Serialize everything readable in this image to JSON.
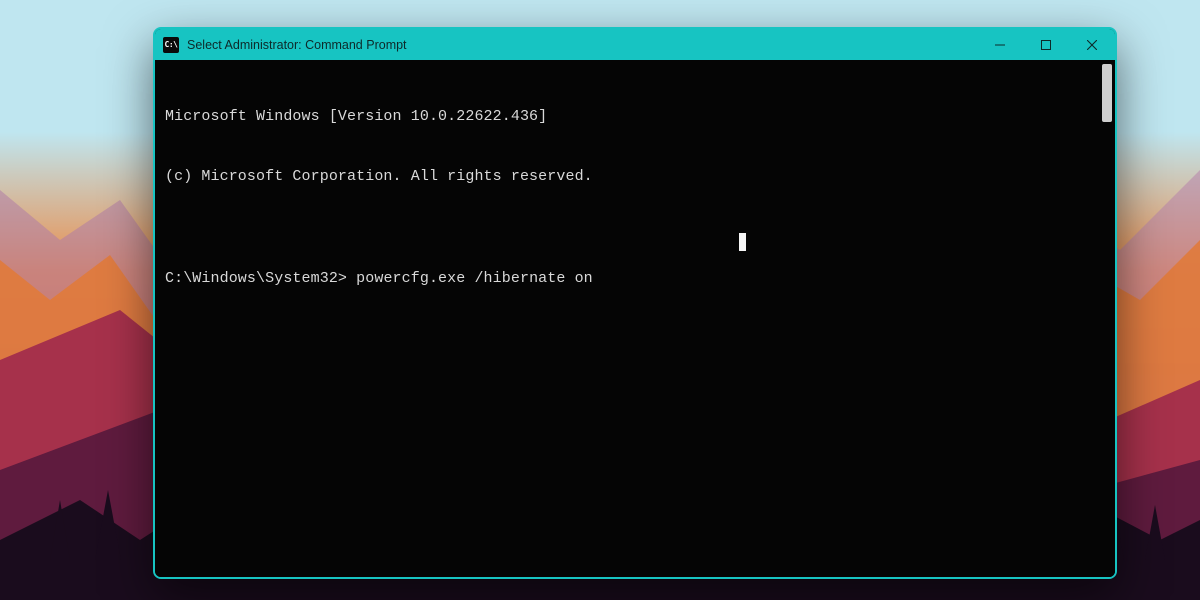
{
  "titlebar": {
    "icon_label": "C:\\",
    "title": "Select Administrator: Command Prompt"
  },
  "terminal": {
    "line1": "Microsoft Windows [Version 10.0.22622.436]",
    "line2": "(c) Microsoft Corporation. All rights reserved.",
    "blank": "",
    "prompt_path": "C:\\Windows\\System32>",
    "command": "powercfg.exe /hibernate on"
  },
  "colors": {
    "accent": "#17c4c2",
    "terminal_bg": "#050505",
    "terminal_fg": "#d9d9d9"
  }
}
